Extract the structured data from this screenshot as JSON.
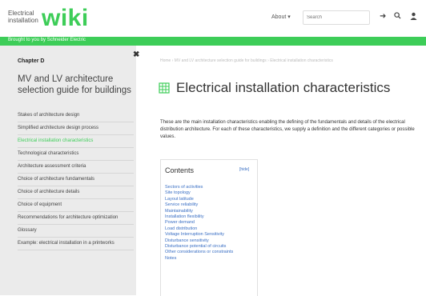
{
  "header": {
    "logo_small": "Electrical installation",
    "logo_wiki": "wiki",
    "about_label": "About ▾",
    "search_placeholder": "Search"
  },
  "banner": {
    "text": "Brought to you by Schneider Electric"
  },
  "sidebar": {
    "chapter": "Chapter D",
    "title": "MV and LV architecture selection guide for buildings",
    "items": [
      {
        "label": "Stakes of architecture design"
      },
      {
        "label": "Simplified architecture design process"
      },
      {
        "label": "Electrical installation characteristics"
      },
      {
        "label": "Technological characteristics"
      },
      {
        "label": "Architecture assessment criteria"
      },
      {
        "label": "Choice of architecture fundamentals"
      },
      {
        "label": "Choice of architecture details"
      },
      {
        "label": "Choice of equipment"
      },
      {
        "label": "Recommendations for architecture optimization"
      },
      {
        "label": "Glossary"
      },
      {
        "label": "Example: electrical installation in a printworks"
      }
    ],
    "close_glyph": "✖"
  },
  "main": {
    "breadcrumb": "Home › MV and LV architecture selection guide for buildings › Electrical installation characteristics",
    "title": "Electrical installation characteristics",
    "intro": "These are the main installation characteristics enabling the defining of the fundamentals and details of the electrical distribution architecture. For each of these characteristics, we supply a definition and the different categories or possible values.",
    "toc": {
      "heading": "Contents",
      "hide_label": "[hide]",
      "items": [
        "Sectors of activities",
        "Site topology",
        "Layout latitude",
        "Service reliability",
        "Maintainability",
        "Installation flexibility",
        "Power demand",
        "Load distribution",
        "Voltage Interruption Sensitivity",
        "Disturbance sensitivity",
        "Disturbance potential of circuits",
        "Other considerations or constraints",
        "Notes"
      ]
    }
  },
  "colors": {
    "brand_green": "#3dcd58",
    "link_blue": "#3a6fc4",
    "sidebar_bg": "#ebebeb"
  }
}
